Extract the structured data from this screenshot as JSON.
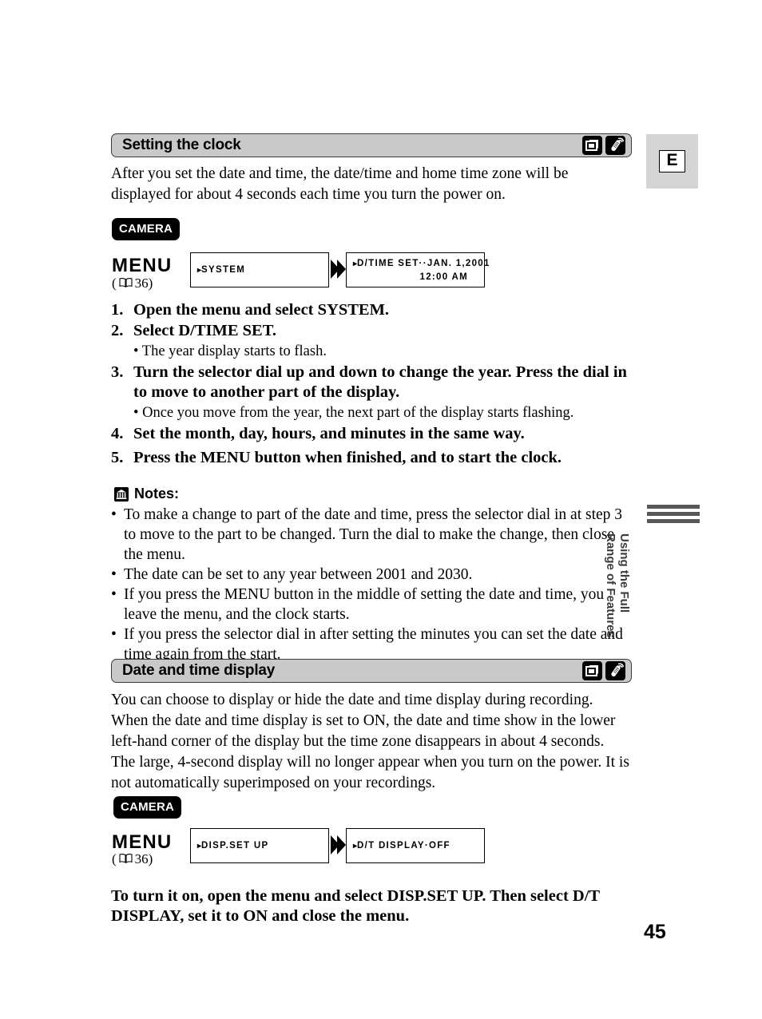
{
  "page": {
    "number": "45",
    "language_tab": "E",
    "side_text_line1": "Using the Full",
    "side_text_line2": "Range of Features"
  },
  "section1": {
    "title": "Setting the clock",
    "icons": [
      "tape-cassette-icon",
      "remote-control-icon"
    ],
    "intro": "After you set the date and time, the date/time and home time zone will be displayed for about 4 seconds each time you turn the power on.",
    "mode_badge": "CAMERA",
    "menu_label": "MENU",
    "menu_ref_open": "(",
    "menu_ref_page": "36)",
    "lcd_left_line1_marker": "▸",
    "lcd_left_line1": "SYSTEM",
    "lcd_right_line1_marker": "▸",
    "lcd_right_line1": "D/TIME SET··JAN. 1,2001",
    "lcd_right_line2": "12:00 AM",
    "steps": [
      {
        "num": "1.",
        "text": "Open the menu and select SYSTEM.",
        "sub": []
      },
      {
        "num": "2.",
        "text": "Select D/TIME SET.",
        "sub": [
          "• The year display starts to flash."
        ]
      },
      {
        "num": "3.",
        "text": "Turn the selector dial up and down to change the year. Press the dial in to move to another part of the display.",
        "sub": [
          "• Once you move from the year, the next part of the display starts flashing."
        ]
      },
      {
        "num": "4.",
        "text": "Set the month, day, hours, and minutes in the same way.",
        "sub": []
      },
      {
        "num": "5.",
        "text": "Press the MENU button when finished, and to start the clock.",
        "sub": []
      }
    ],
    "notes_title": "Notes:",
    "notes": [
      "To make a change to part of the date and time, press the selector dial in at step 3 to move to the part to be changed. Turn the dial to make the change, then close the menu.",
      "The date can be set to any year between 2001 and 2030.",
      "If you press the MENU button in the middle of setting the date and time, you leave the menu, and the clock starts.",
      "If you press the selector dial in after setting the minutes you can set the date and time again from the start."
    ],
    "bullet": "•"
  },
  "section2": {
    "title": "Date and time display",
    "icons": [
      "tape-cassette-icon",
      "remote-control-icon"
    ],
    "intro": "You can choose to display or hide the date and time display during recording. When the date and time display is set to ON, the date and time show in the lower left-hand corner of the display but the time zone disappears in about 4 seconds. The large, 4-second display will no longer appear when you turn on the power. It is not automatically superimposed on your recordings.",
    "mode_badge": "CAMERA",
    "menu_label": "MENU",
    "menu_ref_open": "(",
    "menu_ref_page": "36)",
    "lcd_left_line1_marker": "▸",
    "lcd_left_line1": "DISP.SET UP",
    "lcd_right_line1_marker": "▸",
    "lcd_right_line1": "D/T DISPLAY·OFF",
    "closing": "To turn it on, open the menu and select DISP.SET UP. Then select D/T DISPLAY, set it to ON and close the menu."
  }
}
